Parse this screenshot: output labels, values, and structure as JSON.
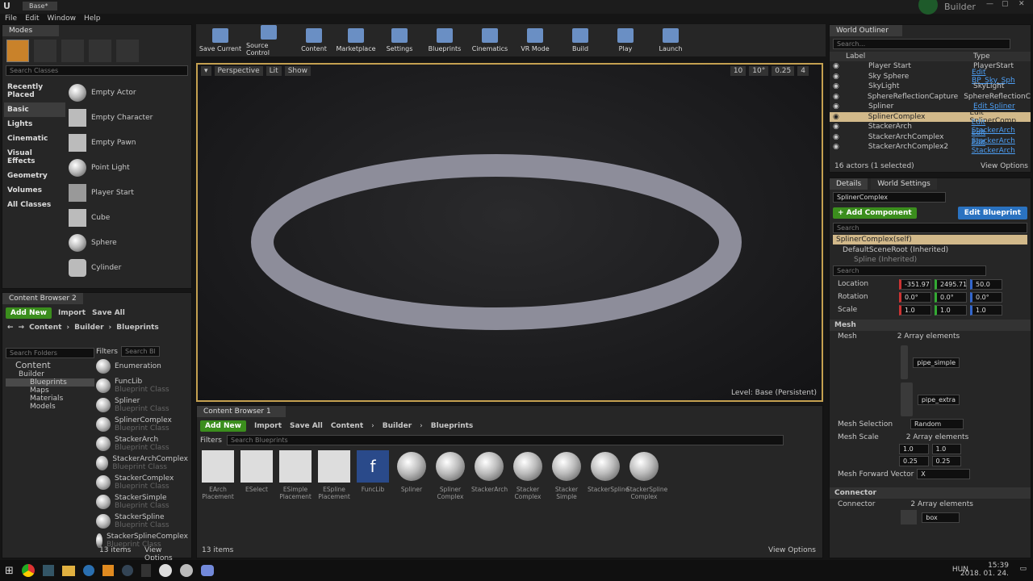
{
  "titlebar": {
    "tab": "Base*",
    "project": "Builder"
  },
  "menu": [
    "File",
    "Edit",
    "Window",
    "Help"
  ],
  "modes": {
    "title": "Modes",
    "search": "Search Classes",
    "categories": [
      "Recently Placed",
      "Basic",
      "Lights",
      "Cinematic",
      "Visual Effects",
      "Geometry",
      "Volumes",
      "All Classes"
    ],
    "items": [
      "Empty Actor",
      "Empty Character",
      "Empty Pawn",
      "Point Light",
      "Player Start",
      "Cube",
      "Sphere",
      "Cylinder"
    ]
  },
  "toolbar": [
    "Save Current",
    "Source Control",
    "Content",
    "Marketplace",
    "Settings",
    "Blueprints",
    "Cinematics",
    "VR Mode",
    "Build",
    "Play",
    "Launch"
  ],
  "viewport": {
    "perspective": "Perspective",
    "lit": "Lit",
    "show": "Show",
    "grid": "10",
    "angle": "10°",
    "scale": "0.25",
    "speed": "4",
    "level_label": "Level:",
    "level_value": "Base (Persistent)"
  },
  "cb2": {
    "title": "Content Browser 2",
    "add": "Add New",
    "import": "Import",
    "saveall": "Save All",
    "path": [
      "Content",
      "Builder",
      "Blueprints"
    ],
    "search_folders": "Search Folders",
    "filters": "Filters",
    "search_bp": "Search Bl",
    "tree": [
      "Content",
      "Builder",
      "Blueprints",
      "Maps",
      "Materials",
      "Models"
    ],
    "assets": [
      {
        "n": "Enumeration",
        "t": ""
      },
      {
        "n": "FuncLib",
        "t": "Blueprint Class"
      },
      {
        "n": "Spliner",
        "t": "Blueprint Class"
      },
      {
        "n": "SplinerComplex",
        "t": "Blueprint Class"
      },
      {
        "n": "StackerArch",
        "t": "Blueprint Class"
      },
      {
        "n": "StackerArchComplex",
        "t": "Blueprint Class"
      },
      {
        "n": "StackerComplex",
        "t": "Blueprint Class"
      },
      {
        "n": "StackerSimple",
        "t": "Blueprint Class"
      },
      {
        "n": "StackerSpline",
        "t": "Blueprint Class"
      },
      {
        "n": "StackerSplineComplex",
        "t": "Blueprint Class"
      }
    ],
    "count": "13 items",
    "viewopts": "View Options"
  },
  "cb1": {
    "title": "Content Browser 1",
    "add": "Add New",
    "import": "Import",
    "saveall": "Save All",
    "path": [
      "Content",
      "Builder",
      "Blueprints"
    ],
    "filters": "Filters",
    "search": "Search Blueprints",
    "assets": [
      "EArch Placement",
      "ESelect",
      "ESimple Placement",
      "ESpline Placement",
      "FuncLib",
      "Spliner",
      "Spliner Complex",
      "StackerArch",
      "Stacker Complex",
      "Stacker Simple",
      "StackerSpline",
      "StackerSpline Complex"
    ],
    "count": "13 items",
    "viewopts": "View Options"
  },
  "outliner": {
    "title": "World Outliner",
    "search": "Search...",
    "col_label": "Label",
    "col_type": "Type",
    "rows": [
      {
        "l": "Player Start",
        "t": "PlayerStart",
        "link": false
      },
      {
        "l": "Sky Sphere",
        "t": "Edit BP_Sky_Sph",
        "link": true
      },
      {
        "l": "SkyLight",
        "t": "SkyLight",
        "link": false
      },
      {
        "l": "SphereReflectionCapture",
        "t": "SphereReflectionC",
        "link": false
      },
      {
        "l": "Spliner",
        "t": "Edit Spliner",
        "link": true
      },
      {
        "l": "SplinerComplex",
        "t": "Edit SplinerComp",
        "link": true,
        "sel": true
      },
      {
        "l": "StackerArch",
        "t": "Edit StackerArch",
        "link": true
      },
      {
        "l": "StackerArchComplex",
        "t": "Edit StackerArch",
        "link": true
      },
      {
        "l": "StackerArchComplex2",
        "t": "Edit StackerArch",
        "link": true
      }
    ],
    "status": "16 actors (1 selected)",
    "viewopts": "View Options"
  },
  "details": {
    "tab1": "Details",
    "tab2": "World Settings",
    "name": "SplinerComplex",
    "add_comp": "+ Add Component",
    "edit_bp": "Edit Blueprint",
    "search": "Search",
    "self": "SplinerComplex(self)",
    "root": "DefaultSceneRoot (Inherited)",
    "spline": "Spline (Inherited)",
    "transform": [
      {
        "l": "Location",
        "x": "-351.97",
        "y": "2495.71",
        "z": "50.0"
      },
      {
        "l": "Rotation",
        "x": "0.0°",
        "y": "0.0°",
        "z": "0.0°"
      },
      {
        "l": "Scale",
        "x": "1.0",
        "y": "1.0",
        "z": "1.0"
      }
    ],
    "mesh_section": "Mesh",
    "mesh_label": "Mesh",
    "mesh_count": "2 Array elements",
    "mesh0": "pipe_simple",
    "mesh1": "pipe_extra",
    "mesh_sel_label": "Mesh Selection",
    "mesh_sel": "Random",
    "mesh_scale_label": "Mesh Scale",
    "mesh_scale_count": "2 Array elements",
    "ms0x": "1.0",
    "ms0y": "1.0",
    "ms1x": "0.25",
    "ms1y": "0.25",
    "fwd_label": "Mesh Forward Vector",
    "fwd": "X",
    "conn_section": "Connector",
    "conn_label": "Connector",
    "conn_count": "2 Array elements",
    "conn0": "box"
  },
  "taskbar": {
    "lang": "HUN",
    "time": "15:39",
    "date": "2018. 01. 24."
  }
}
